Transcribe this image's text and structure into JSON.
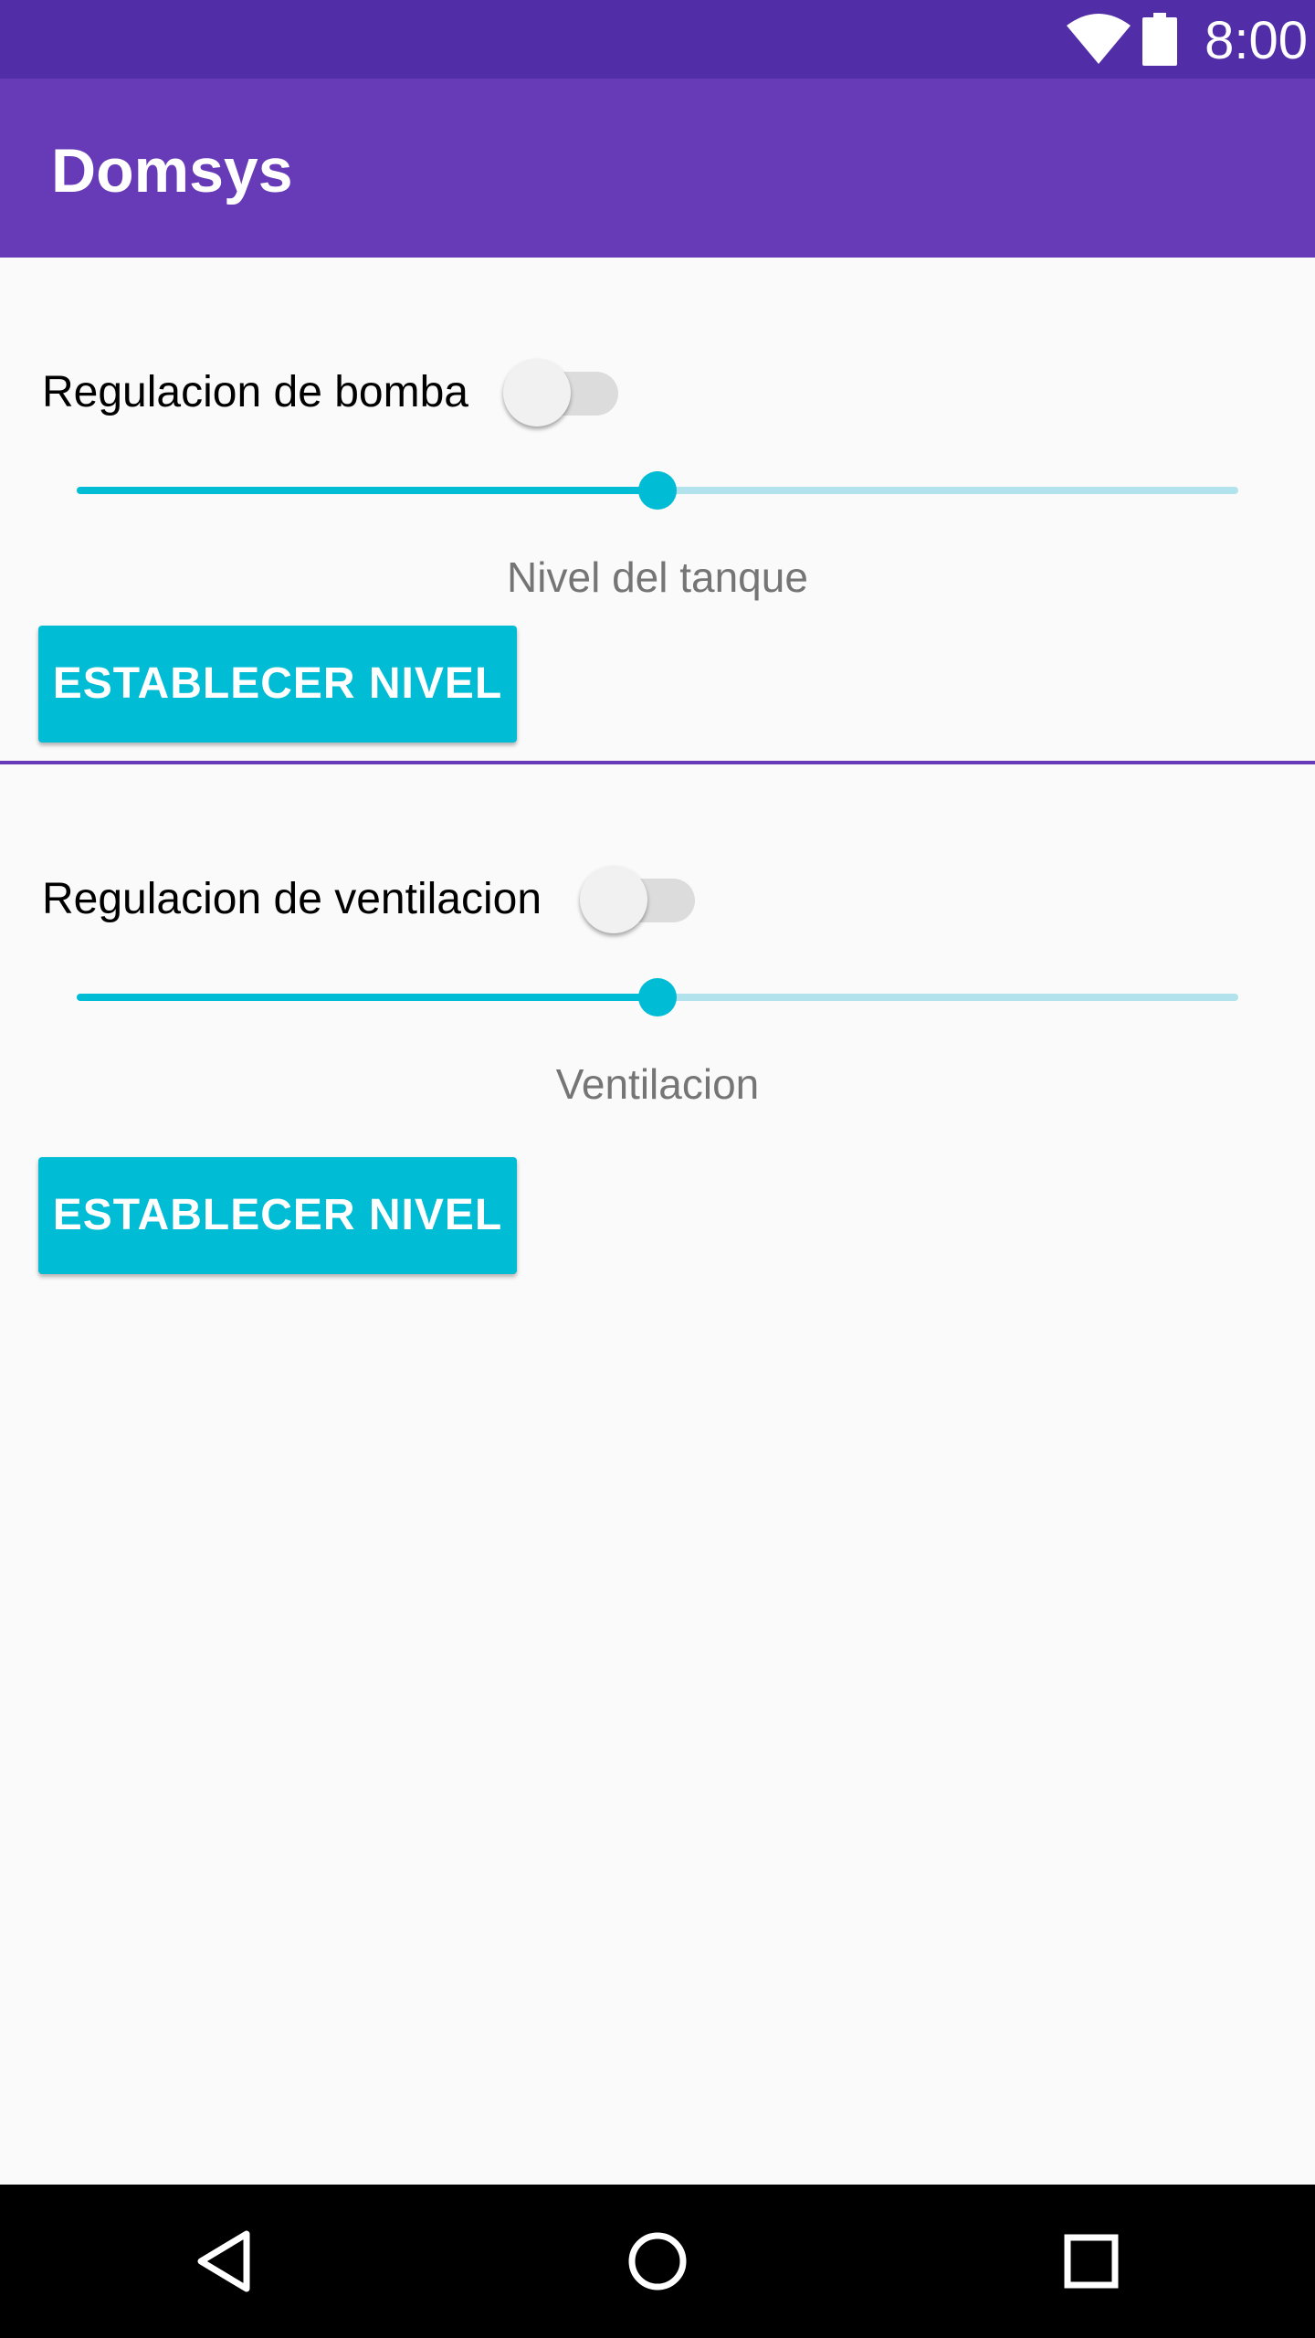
{
  "status_bar": {
    "time": "8:00",
    "icons": [
      "wifi-icon",
      "battery-icon"
    ],
    "color": "#512da8"
  },
  "app_bar": {
    "title": "Domsys",
    "color": "#673ab7"
  },
  "sections": [
    {
      "switch_label": "Regulacion de bomba",
      "switch_on": false,
      "slider_value": 0.5,
      "caption": "Nivel del tanque",
      "button_label": "ESTABLECER NIVEL"
    },
    {
      "switch_label": "Regulacion de ventilacion",
      "switch_on": false,
      "slider_value": 0.5,
      "caption": "Ventilacion",
      "button_label": "ESTABLECER NIVEL"
    }
  ],
  "accent_color": "#00bcd4",
  "nav_bar": {
    "icons": [
      "back-icon",
      "home-icon",
      "recents-icon"
    ]
  }
}
